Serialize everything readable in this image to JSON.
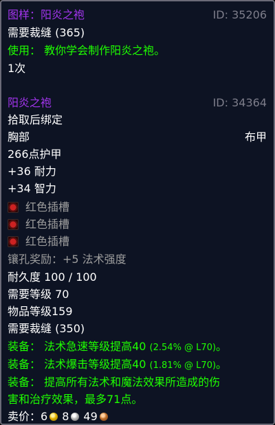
{
  "recipe": {
    "title": "图样：阳炎之袍",
    "id_label": "ID: 35206",
    "req_tailoring": "需要裁缝 (365)",
    "use_text": "使用：  教你学会制作阳炎之袍。",
    "charges": "1次"
  },
  "item": {
    "name": "阳炎之袍",
    "id_label": "ID: 34364",
    "bind": "拾取后绑定",
    "slot": "胸部",
    "armor_type": "布甲",
    "armor": "266点护甲",
    "stats": [
      "+36 耐力",
      "+34 智力"
    ],
    "sockets": [
      "红色插槽",
      "红色插槽",
      "红色插槽"
    ],
    "socket_bonus": "镶孔奖励：+5 法术强度",
    "durability": "耐久度 100 / 100",
    "req_level": "需要等级 70",
    "item_level": "物品等级159",
    "req_tailoring": "需要裁缝 (350)",
    "equip": [
      {
        "text": "装备：  法术急速等级提高40 ",
        "note": "(2.54% @ L70)",
        "end": "。"
      },
      {
        "text": "装备：  法术爆击等级提高40 ",
        "note": "(1.81% @ L70)",
        "end": "。"
      }
    ],
    "equip3_line1": "装备：  提高所有法术和魔法效果所造成的伤",
    "equip3_line2": "害和治疗效果，最多71点。"
  },
  "sell": {
    "label": "卖价：",
    "gold": "6",
    "silver": "8",
    "copper": "49"
  },
  "colors": {
    "epic": "#a335ee",
    "green": "#1eff00",
    "background": "#0d1323",
    "id_grey": "#7d7d8a"
  },
  "icons": [
    "red-socket-icon",
    "gold-coin-icon",
    "silver-coin-icon",
    "copper-coin-icon"
  ]
}
